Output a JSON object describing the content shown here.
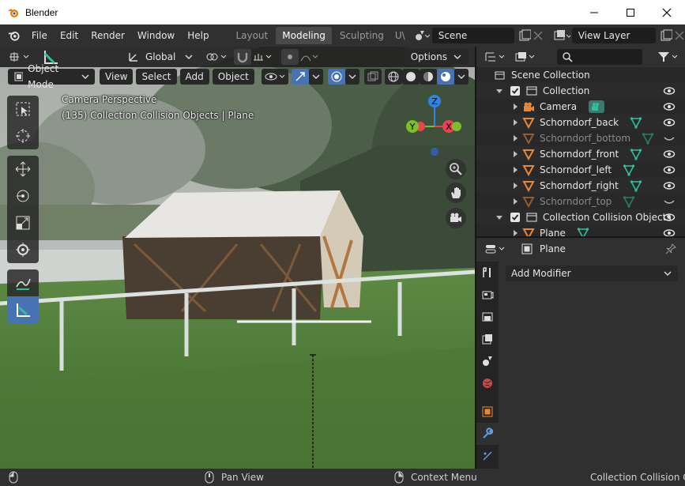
{
  "window": {
    "title": "Blender"
  },
  "menu": {
    "items": [
      "File",
      "Edit",
      "Render",
      "Window",
      "Help"
    ]
  },
  "workspaces": {
    "tabs": [
      "Layout",
      "Modeling",
      "Sculpting",
      "U\\"
    ],
    "active": "Modeling"
  },
  "scene": {
    "label": "Scene"
  },
  "viewlayer": {
    "label": "View Layer"
  },
  "viewport": {
    "orientation": "Global",
    "options_label": "Options",
    "mode": "Object Mode",
    "menus": [
      "View",
      "Select",
      "Add",
      "Object"
    ],
    "overlay_title": "Camera Perspective",
    "overlay_subtitle": "(135) Collection Collision Objects | Plane",
    "gizmo": {
      "z": "Z",
      "y": "Y",
      "x": "X"
    }
  },
  "outliner": {
    "root": "Scene Collection",
    "rows": [
      {
        "label": "Collection",
        "type": "collection",
        "indent": 1,
        "dim": false
      },
      {
        "label": "Camera",
        "type": "camera",
        "indent": 2,
        "dim": false
      },
      {
        "label": "Schorndorf_back",
        "type": "mesh",
        "indent": 2,
        "dim": false
      },
      {
        "label": "Schorndorf_bottom",
        "type": "mesh",
        "indent": 2,
        "dim": true
      },
      {
        "label": "Schorndorf_front",
        "type": "mesh",
        "indent": 2,
        "dim": false
      },
      {
        "label": "Schorndorf_left",
        "type": "mesh",
        "indent": 2,
        "dim": false
      },
      {
        "label": "Schorndorf_right",
        "type": "mesh",
        "indent": 2,
        "dim": false
      },
      {
        "label": "Schorndorf_top",
        "type": "mesh",
        "indent": 2,
        "dim": true
      },
      {
        "label": "Collection Collision Objects",
        "type": "collection",
        "indent": 1,
        "dim": false
      },
      {
        "label": "Plane",
        "type": "mesh",
        "indent": 2,
        "dim": false
      }
    ]
  },
  "properties": {
    "object_name": "Plane",
    "add_modifier": "Add Modifier"
  },
  "status": {
    "pan_view": "Pan View",
    "context_menu": "Context Menu",
    "right_text": "Collection Collision Obje"
  },
  "colors": {
    "accent": "#4772b3",
    "mesh_icon": "#e8873a",
    "vertex_green": "#2fbf9f",
    "x_axis": "#e8434f",
    "y_axis": "#7cbf28",
    "z_axis": "#2f85e2"
  }
}
